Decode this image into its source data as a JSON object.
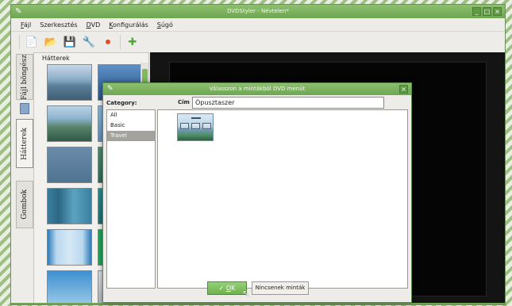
{
  "window": {
    "title": "DVDStyler - Névtelen*",
    "controls": [
      "_",
      "□",
      "×"
    ]
  },
  "menu": [
    {
      "mnemonic": "F",
      "rest": "ájl"
    },
    {
      "mnemonic": "",
      "rest": "Szerkesztés"
    },
    {
      "mnemonic": "D",
      "rest": "VD"
    },
    {
      "mnemonic": "K",
      "rest": "onfigurálás"
    },
    {
      "mnemonic": "S",
      "rest": "úgó"
    }
  ],
  "toolbar": {
    "new_icon": "📄",
    "open_icon": "📂",
    "save_icon": "💾",
    "settings_icon": "🔧",
    "burn_icon": "⏺",
    "add_icon": "✚"
  },
  "side_tabs": {
    "file_browser": "Fájl böngész",
    "backgrounds": "Hátterek",
    "buttons": "Gombok"
  },
  "thumb_panel": {
    "title": "Hátterek"
  },
  "dialog": {
    "title": "Válasszon a mintákból DVD menüt",
    "close": "×",
    "category_label": "Category:",
    "categories": [
      {
        "label": "All",
        "selected": false
      },
      {
        "label": "Basic",
        "selected": false
      },
      {
        "label": "Travel",
        "selected": true
      }
    ],
    "title_label": "Cím",
    "title_value": "Ópusztaszer",
    "ok_check": "✓",
    "ok_mnemonic": "O",
    "ok_rest": "K",
    "no_template": "Nincsenek minták"
  },
  "colors": {
    "titlebar": "#7cb35f",
    "accent": "#6fb24e",
    "selection": "#a3a29d",
    "preview_bg": "#141414"
  }
}
